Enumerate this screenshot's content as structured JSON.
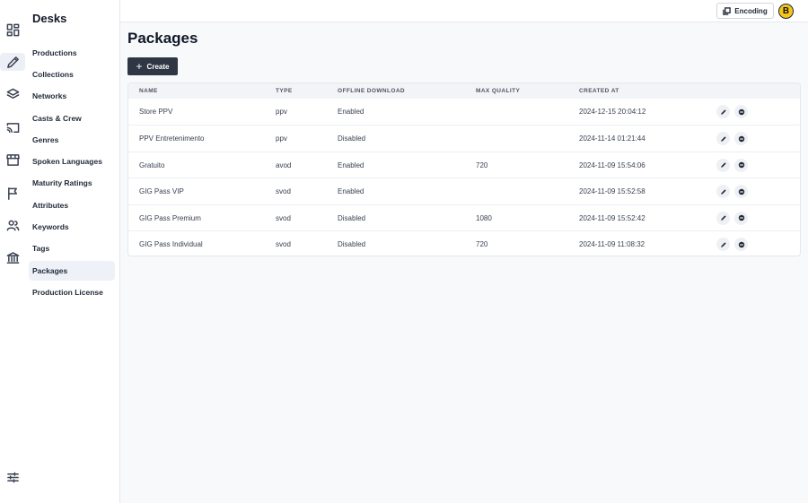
{
  "sidebar": {
    "title": "Desks",
    "items": [
      {
        "label": "Productions"
      },
      {
        "label": "Collections"
      },
      {
        "label": "Networks"
      },
      {
        "label": "Casts & Crew"
      },
      {
        "label": "Genres"
      },
      {
        "label": "Spoken Languages"
      },
      {
        "label": "Maturity Ratings"
      },
      {
        "label": "Attributes"
      },
      {
        "label": "Keywords"
      },
      {
        "label": "Tags"
      },
      {
        "label": "Packages",
        "active": true
      },
      {
        "label": "Production License"
      }
    ]
  },
  "rail_icons": [
    "dashboard-icon",
    "pencil-icon",
    "layers-icon",
    "cast-icon",
    "store-icon",
    "flag-icon",
    "users-icon",
    "bank-icon"
  ],
  "topbar": {
    "encoding_label": "Encoding",
    "avatar_letter": "B",
    "avatar_color": "#f5c518"
  },
  "page": {
    "title": "Packages",
    "create_label": "Create"
  },
  "table": {
    "columns": [
      "NAME",
      "TYPE",
      "OFFLINE DOWNLOAD",
      "MAX QUALITY",
      "CREATED AT"
    ],
    "rows": [
      {
        "name": "Store PPV",
        "type": "ppv",
        "offline": "Enabled",
        "quality": "",
        "created": "2024-12-15 20:04:12"
      },
      {
        "name": "PPV Entretenimento",
        "type": "ppv",
        "offline": "Disabled",
        "quality": "",
        "created": "2024-11-14 01:21:44"
      },
      {
        "name": "Gratuito",
        "type": "avod",
        "offline": "Enabled",
        "quality": "720",
        "created": "2024-11-09 15:54:06"
      },
      {
        "name": "GIG Pass VIP",
        "type": "svod",
        "offline": "Enabled",
        "quality": "",
        "created": "2024-11-09 15:52:58"
      },
      {
        "name": "GIG Pass Premium",
        "type": "svod",
        "offline": "Disabled",
        "quality": "1080",
        "created": "2024-11-09 15:52:42"
      },
      {
        "name": "GIG Pass Individual",
        "type": "svod",
        "offline": "Disabled",
        "quality": "720",
        "created": "2024-11-09 11:08:32"
      }
    ]
  },
  "colors": {
    "primary_button": "#2f3744",
    "active_nav": "#eef1f7"
  }
}
